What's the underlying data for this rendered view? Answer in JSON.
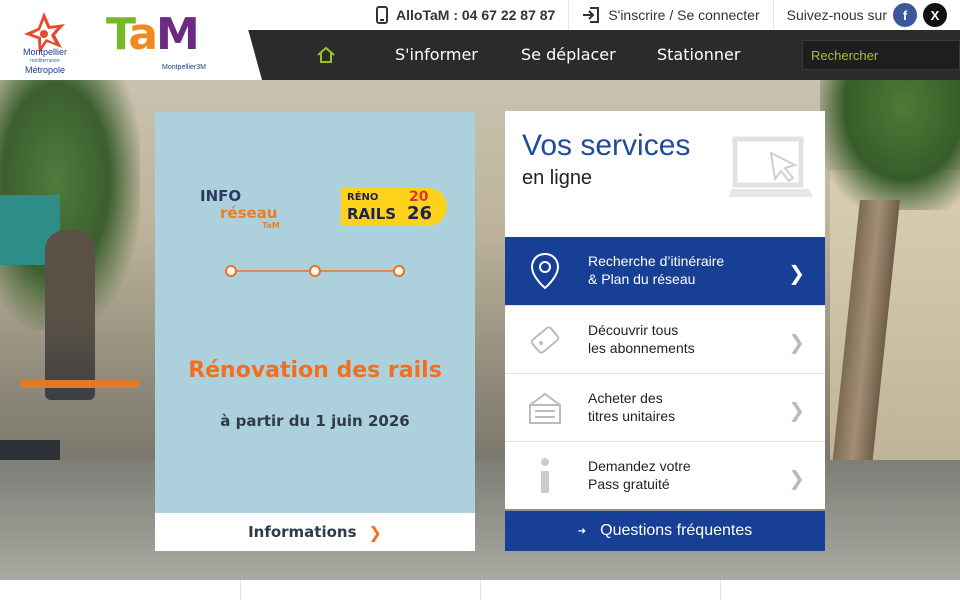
{
  "logos": {
    "metropole": {
      "line1": "Montpellier",
      "line2": "méditerranée",
      "line3": "Métropole"
    },
    "tam": {
      "t": "T",
      "a": "a",
      "m": "M",
      "sub": "Montpellier3M"
    }
  },
  "topbar": {
    "allotam": "AlloTaM : 04 67 22 87 87",
    "login": "S'inscrire / Se connecter",
    "follow": "Suivez-nous sur",
    "facebook": "f",
    "x": "X"
  },
  "nav": {
    "items": [
      "S'informer",
      "Se déplacer",
      "Stationner"
    ],
    "search_placeholder": "Rechercher"
  },
  "info_card": {
    "logo_line1": "INFO",
    "logo_line2": "réseau",
    "logo_line3": "TaM",
    "badge": {
      "reno": "RÉNO",
      "rails": "RAILS",
      "y1": "20",
      "y2": "26"
    },
    "title": "Rénovation des rails",
    "subtitle": "à partir du 1 juin 2026",
    "button": "Informations"
  },
  "services": {
    "title": "Vos services",
    "subtitle": "en ligne",
    "items": [
      {
        "line1": "Recherche d’itinéraire",
        "line2": "& Plan du réseau",
        "icon": "map-pin-icon"
      },
      {
        "line1": "Découvrir tous",
        "line2": "les abonnements",
        "icon": "ticket-icon"
      },
      {
        "line1": "Acheter des",
        "line2": "titres unitaires",
        "icon": "ticket-stack-icon"
      },
      {
        "line1": "Demandez votre",
        "line2": "Pass gratuité",
        "icon": "info-icon"
      }
    ],
    "faq": "Questions fréquentes"
  },
  "colors": {
    "brand_blue": "#173f95",
    "brand_orange": "#f07020",
    "nav_dark": "#2b2b2b",
    "search_green": "#a6c22f",
    "card_blue": "#add0dd"
  }
}
